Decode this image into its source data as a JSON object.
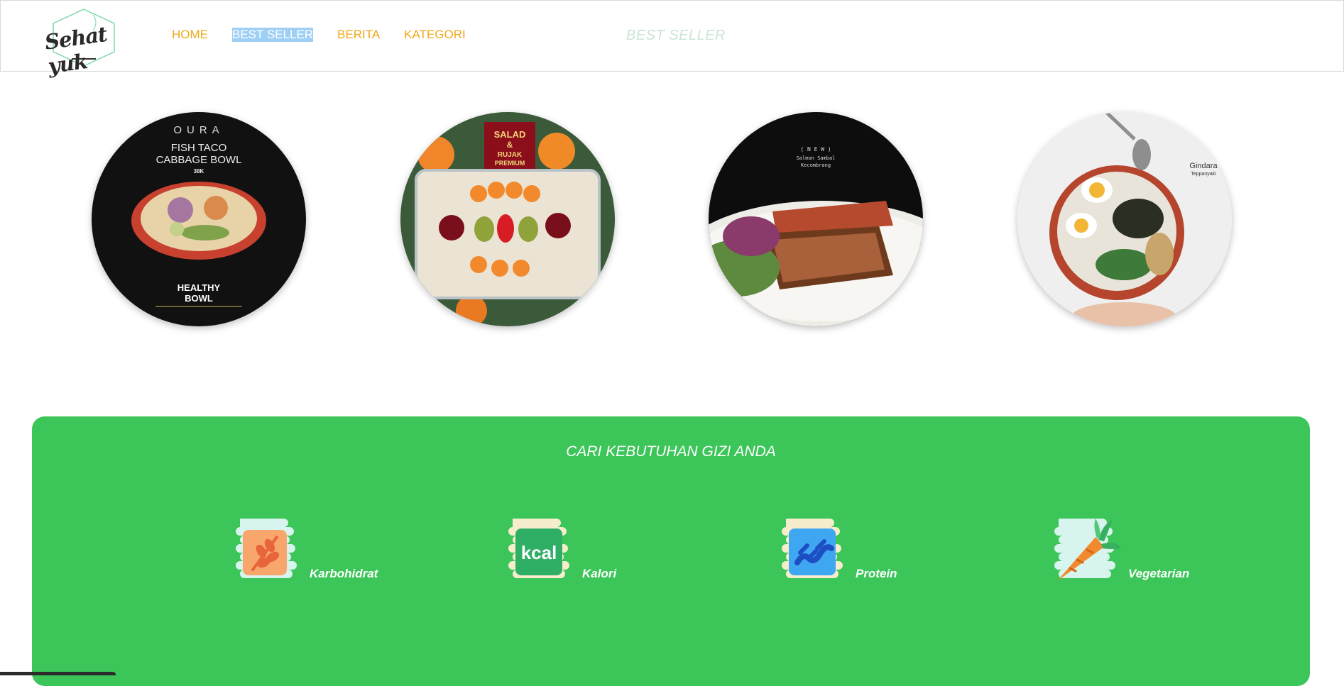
{
  "header": {
    "logo_text": "Sehat yuk",
    "nav": [
      {
        "label": "HOME"
      },
      {
        "label": "BEST SELLER"
      },
      {
        "label": "BERITA"
      },
      {
        "label": "KATEGORI"
      }
    ],
    "faded_title": "BEST SELLER"
  },
  "best_sellers": {
    "items": [
      {
        "image": "fish-taco-bowl-photo",
        "brand": "OURA",
        "line1": "FISH TACO",
        "line2": "CABBAGE BOWL",
        "price": "38K",
        "footer1": "HEALTHY",
        "footer2": "BOWL"
      },
      {
        "image": "salad-box-photo",
        "badge1": "SALAD",
        "badge2": "&",
        "badge3": "RUJAK",
        "badge4": "PREMIUM"
      },
      {
        "image": "salmon-plate-photo",
        "tag": "( N E W )",
        "name1": "Salmon Sambal",
        "name2": "Kecombrang"
      },
      {
        "image": "rice-bowl-photo",
        "brand1": "Gindara",
        "brand2": "Teppanyaki"
      }
    ]
  },
  "nutrition": {
    "title": "CARI KEBUTUHAN GIZI ANDA",
    "categories": [
      {
        "label": "Karbohidrat",
        "icon": "wheat-icon"
      },
      {
        "label": "Kalori",
        "icon": "kcal-icon",
        "icon_text": "kcal"
      },
      {
        "label": "Protein",
        "icon": "protein-helix-icon"
      },
      {
        "label": "Vegetarian",
        "icon": "carrot-icon"
      }
    ]
  },
  "colors": {
    "nav": "#f0a818",
    "nav_selected_bg": "#9ecff5",
    "panel": "#3cc558"
  }
}
